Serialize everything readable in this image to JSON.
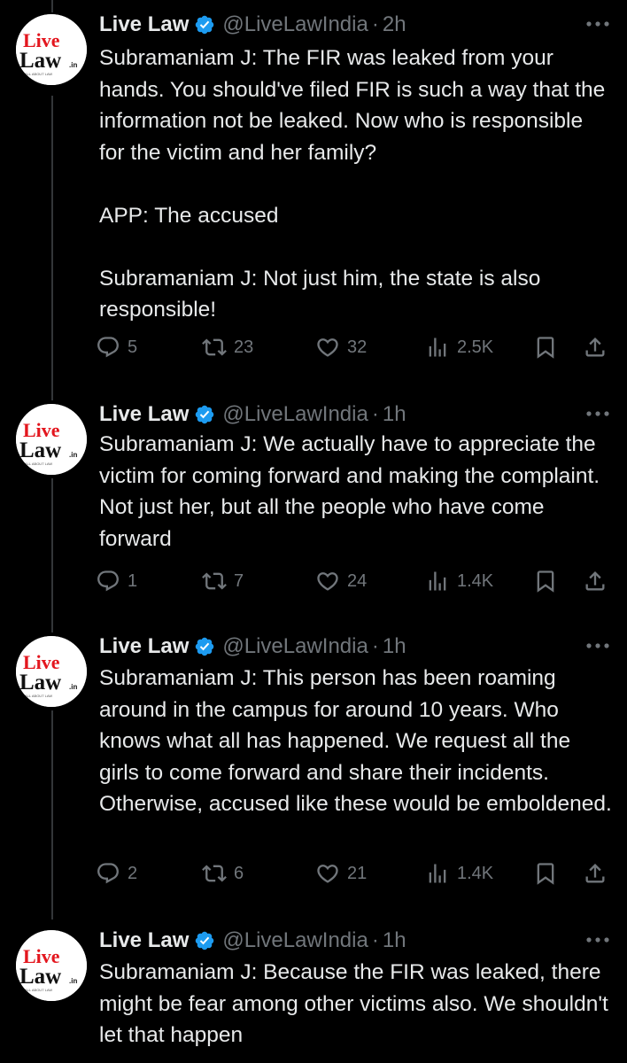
{
  "account": {
    "name": "Live Law",
    "handle": "@LiveLawIndia",
    "separator": "·",
    "logo_text_line1": "Live",
    "logo_text_line2": "Law",
    "logo_suffix": ".in",
    "logo_tagline": "ALL ABOUT LAW"
  },
  "colors": {
    "background": "#000000",
    "text": "#e7e9ea",
    "secondary": "#71767b",
    "verified": "#1d9bf0",
    "logo_red": "#e3161e"
  },
  "tweets": [
    {
      "time": "2h",
      "paragraphs": [
        "Subramaniam J: The FIR was leaked from your hands. You should've filed FIR is such a way that the information not be leaked. Now who is responsible for the victim and her family?",
        "APP: The accused",
        "Subramaniam J: Not just him, the state is also responsible!"
      ],
      "replies": "5",
      "reposts": "23",
      "likes": "32",
      "views": "2.5K"
    },
    {
      "time": "1h",
      "paragraphs": [
        "Subramaniam J: We actually have to appreciate the victim for coming forward and making the complaint. Not just her, but all the people who have come forward"
      ],
      "replies": "1",
      "reposts": "7",
      "likes": "24",
      "views": "1.4K"
    },
    {
      "time": "1h",
      "paragraphs": [
        "Subramaniam J: This person has been roaming around in the campus for around 10 years. Who knows what all has happened. We request all the girls to come forward and share their incidents. Otherwise, accused like these would be emboldened."
      ],
      "replies": "2",
      "reposts": "6",
      "likes": "21",
      "views": "1.4K"
    },
    {
      "time": "1h",
      "paragraphs": [
        "Subramaniam J: Because the FIR was leaked, there might be fear among other victims also. We shouldn't let that happen"
      ]
    }
  ]
}
